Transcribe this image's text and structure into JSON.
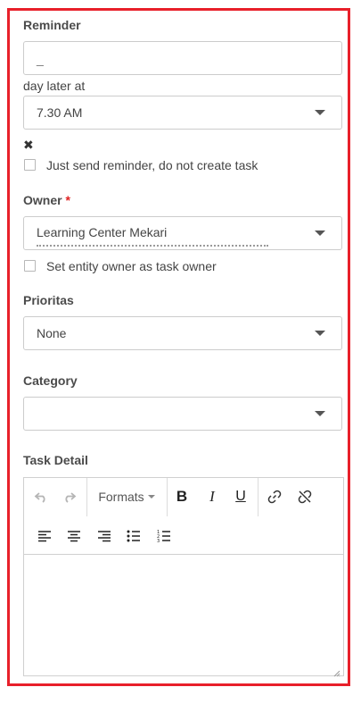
{
  "reminder": {
    "label": "Reminder",
    "input_value": "_",
    "day_later_text": "day later at",
    "time_value": "7.30 AM",
    "remove_symbol": "✖",
    "just_send_label": "Just send reminder, do not create task"
  },
  "owner": {
    "label": "Owner",
    "required_mark": "*",
    "value_line1": "Learning Center Mekari",
    "entity_owner_label": "Set entity owner as task owner"
  },
  "prioritas": {
    "label": "Prioritas",
    "value": "None"
  },
  "category": {
    "label": "Category",
    "value": ""
  },
  "task_detail": {
    "label": "Task Detail",
    "formats_label": "Formats",
    "bold_label": "B",
    "italic_label": "I",
    "underline_label": "U"
  },
  "colors": {
    "frame_border": "#e8202a",
    "required": "#e02020"
  }
}
